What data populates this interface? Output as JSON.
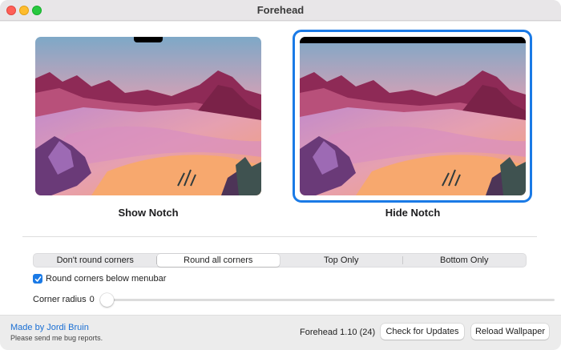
{
  "window": {
    "title": "Forehead"
  },
  "wallpapers": [
    {
      "label": "Show Notch"
    },
    {
      "label": "Hide Notch"
    }
  ],
  "corners": {
    "options": [
      "Don't round corners",
      "Round all corners",
      "Top Only",
      "Bottom Only"
    ],
    "selected": "Round all corners"
  },
  "menubar_option": {
    "label": "Round corners below menubar",
    "checked": true
  },
  "radius": {
    "label": "Corner radius",
    "value": "0"
  },
  "footer": {
    "made_by": "Made by Jordi Bruin",
    "bug_note": "Please send me bug reports.",
    "version": "Forehead 1.10 (24)",
    "check_updates_label": "Check for Updates",
    "reload_label": "Reload Wallpaper"
  },
  "colors": {
    "accent": "#1a7ae6",
    "link": "#1a6fd4"
  }
}
